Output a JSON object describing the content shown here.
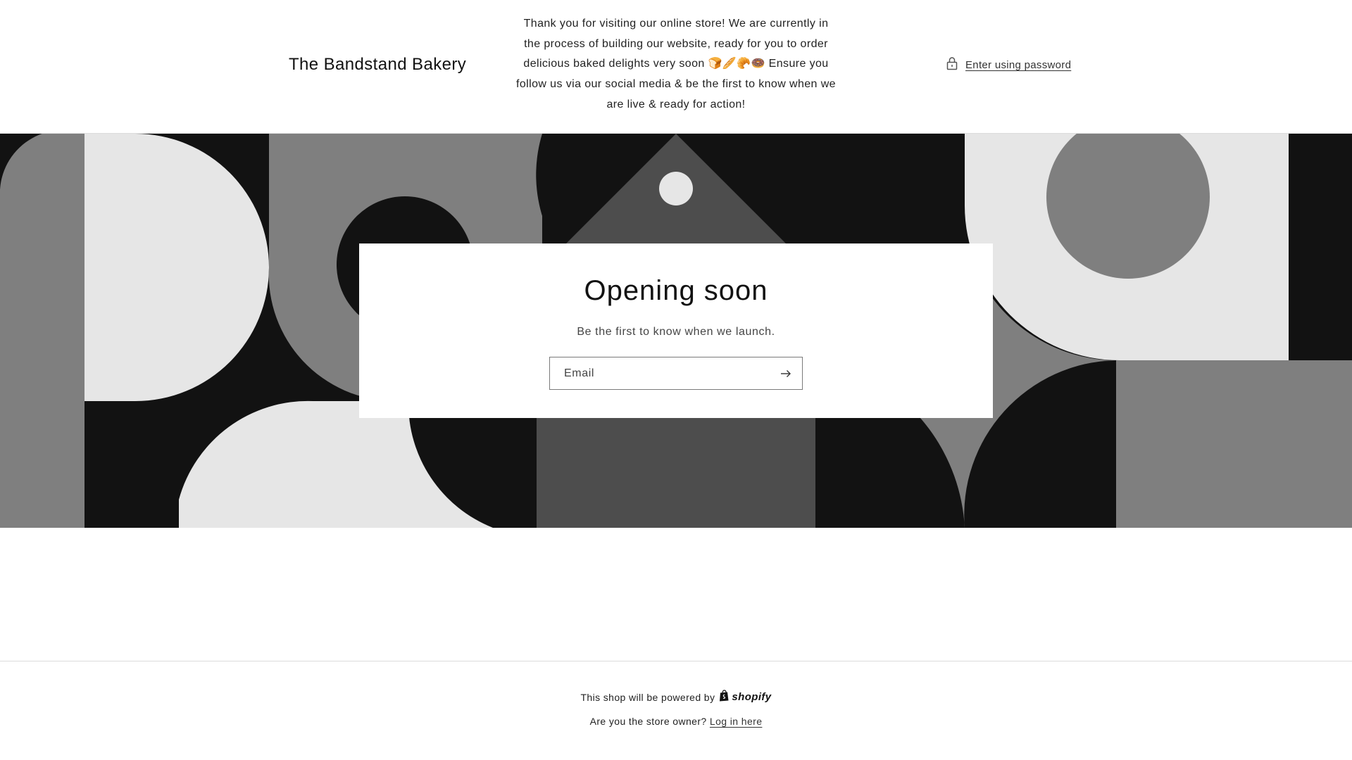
{
  "header": {
    "store_name": "The Bandstand Bakery",
    "announcement": "Thank you for visiting our online store! We are currently in the process of building our website, ready for you to order delicious baked delights very soon 🍞🥖🥐🍩 Ensure you follow us via our social media & be the first to know when we are live & ready for action!",
    "password_link": "Enter using password",
    "lock_icon": "lock-icon"
  },
  "banner": {
    "colors": {
      "black": "#121212",
      "dark_gray": "#4d4d4d",
      "mid_gray": "#7f7f7f",
      "light_gray": "#e6e6e6"
    }
  },
  "signup": {
    "title": "Opening soon",
    "subtitle": "Be the first to know when we launch.",
    "email_placeholder": "Email",
    "submit_icon": "arrow-right-icon"
  },
  "footer": {
    "powered_prefix": "This shop will be powered by",
    "shopify_label": "shopify",
    "owner_prefix": "Are you the store owner?",
    "login_link": "Log in here"
  }
}
